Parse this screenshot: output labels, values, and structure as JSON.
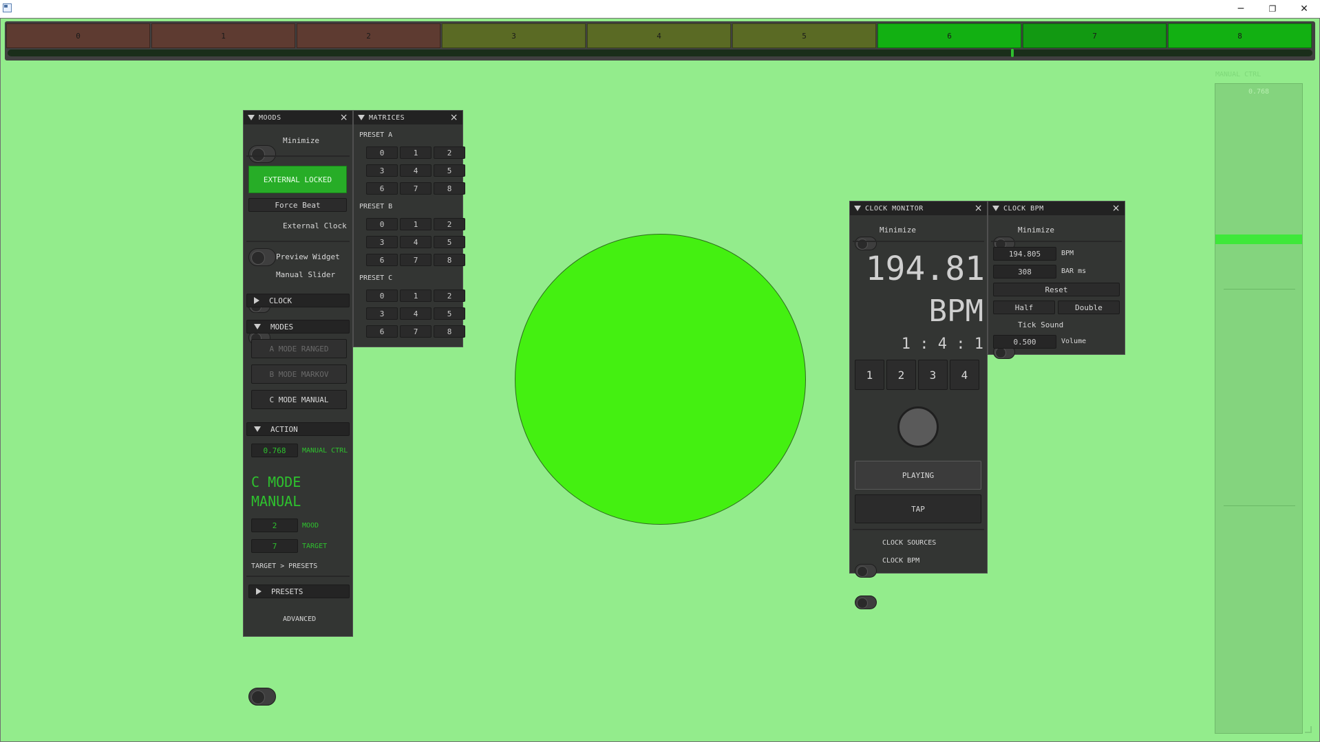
{
  "window": {
    "minimize": "─",
    "restore": "❐",
    "close": "✕"
  },
  "beatbar": {
    "segments": [
      {
        "label": "0",
        "color": "#5e3b31"
      },
      {
        "label": "1",
        "color": "#5e3b31"
      },
      {
        "label": "2",
        "color": "#5e3b31"
      },
      {
        "label": "3",
        "color": "#5a6a24"
      },
      {
        "label": "4",
        "color": "#5a6a24"
      },
      {
        "label": "5",
        "color": "#5a6a24"
      },
      {
        "label": "6",
        "color": "#12b012"
      },
      {
        "label": "7",
        "color": "#129912"
      },
      {
        "label": "8",
        "color": "#12b012"
      }
    ],
    "progress": 0.77
  },
  "moods": {
    "title": "MOODS",
    "minimize": "Minimize",
    "external_locked": "EXTERNAL LOCKED",
    "force_beat": "Force Beat",
    "external_clock": "External Clock",
    "preview_widget": "Preview Widget",
    "manual_slider": "Manual Slider",
    "clock": "CLOCK",
    "modes": "MODES",
    "mode_a": "A MODE RANGED",
    "mode_b": "B MODE MARKOV",
    "mode_c": "C MODE MANUAL",
    "action": "ACTION",
    "manual_ctrl_value": "0.768",
    "manual_ctrl_label": "MANUAL CTRL",
    "mode_title": "C MODE MANUAL",
    "mood_value": "2",
    "mood_label": "MOOD",
    "target_value": "7",
    "target_label": "TARGET",
    "target_presets": "TARGET > PRESETS",
    "presets": "PRESETS",
    "advanced": "ADVANCED"
  },
  "matrices": {
    "title": "MATRICES",
    "preset_a": "PRESET A",
    "preset_b": "PRESET B",
    "preset_c": "PRESET C",
    "buttons": [
      "0",
      "1",
      "2",
      "3",
      "4",
      "5",
      "6",
      "7",
      "8"
    ]
  },
  "preview": {
    "color": "#44f011"
  },
  "clock_monitor": {
    "title": "CLOCK MONITOR",
    "minimize": "Minimize",
    "bpm_value": "194.81",
    "bpm_unit": "BPM",
    "position": "1 : 4 : 1",
    "beats": [
      "1",
      "2",
      "3",
      "4"
    ],
    "playing": "PLAYING",
    "tap": "TAP",
    "clock_sources": "CLOCK SOURCES",
    "clock_bpm": "CLOCK BPM"
  },
  "clock_bpm": {
    "title": "CLOCK BPM",
    "minimize": "Minimize",
    "bpm_value": "194.805",
    "bpm_label": "BPM",
    "bar_value": "308",
    "bar_label": "BAR ms",
    "reset": "Reset",
    "half": "Half",
    "double": "Double",
    "tick_sound": "Tick Sound",
    "volume_value": "0.500",
    "volume_label": "Volume"
  },
  "manual_slider": {
    "label": "MANUAL CTRL",
    "value": "0.768",
    "level": 0.768
  }
}
